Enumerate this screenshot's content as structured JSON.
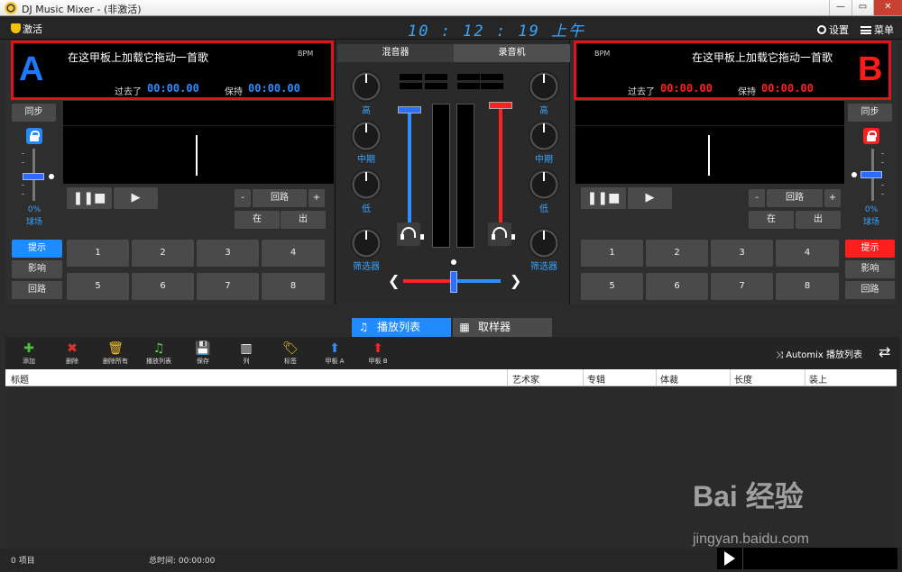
{
  "window": {
    "title": "DJ Music Mixer - (非激活)",
    "min": "—",
    "max": "▭",
    "close": "✕"
  },
  "topbar": {
    "activate": "激活",
    "clock": "10 : 12 : 19 上午",
    "settings": "设置",
    "menu": "菜单"
  },
  "deckA": {
    "letter": "A",
    "song_hint": "在这甲板上加载它拖动一首歌",
    "bpm": "BPM",
    "elapsed_label": "过去了",
    "elapsed_value": "00:00.00",
    "remain_label": "保持",
    "remain_value": "00:00.00",
    "sync": "同步",
    "pitch_pct": "0%",
    "pitch_label": "球场",
    "loop_minus": "-",
    "loop": "回路",
    "loop_plus": "+",
    "in": "在",
    "out": "出",
    "side_buttons": [
      "提示",
      "影响",
      "回路"
    ],
    "pads": [
      "1",
      "2",
      "3",
      "4",
      "5",
      "6",
      "7",
      "8"
    ]
  },
  "deckB": {
    "letter": "B",
    "song_hint": "在这甲板上加载它拖动一首歌",
    "bpm": "BPM",
    "elapsed_label": "过去了",
    "elapsed_value": "00:00.00",
    "remain_label": "保持",
    "remain_value": "00:00.00",
    "sync": "同步",
    "pitch_pct": "0%",
    "pitch_label": "球场",
    "loop_minus": "-",
    "loop": "回路",
    "loop_plus": "+",
    "in": "在",
    "out": "出",
    "side_buttons": [
      "提示",
      "影响",
      "回路"
    ],
    "pads": [
      "1",
      "2",
      "3",
      "4",
      "5",
      "6",
      "7",
      "8"
    ]
  },
  "mixer": {
    "tab_mixer": "混音器",
    "tab_recorder": "录音机",
    "eq_labels": [
      "高",
      "中期",
      "低",
      "筛选器"
    ]
  },
  "tabs": {
    "playlist": "播放列表",
    "sampler": "取样器"
  },
  "toolbar": {
    "items": [
      "添加",
      "删除",
      "删除所有",
      "播放列表",
      "保存",
      "列",
      "标签",
      "甲板 A",
      "甲板 B"
    ],
    "automix": "Automix 播放列表"
  },
  "table": {
    "columns": [
      "标题",
      "艺术家",
      "专辑",
      "体裁",
      "长度",
      "装上"
    ]
  },
  "status": {
    "count": "0  项目",
    "total": "总时间: 00:00:00"
  },
  "watermark": {
    "brand": "Bai 经验",
    "url": "jingyan.baidu.com"
  },
  "colors": {
    "accent_blue": "#1f8bff",
    "accent_red": "#ff1e1e",
    "highlight_box": "#e2121a"
  }
}
